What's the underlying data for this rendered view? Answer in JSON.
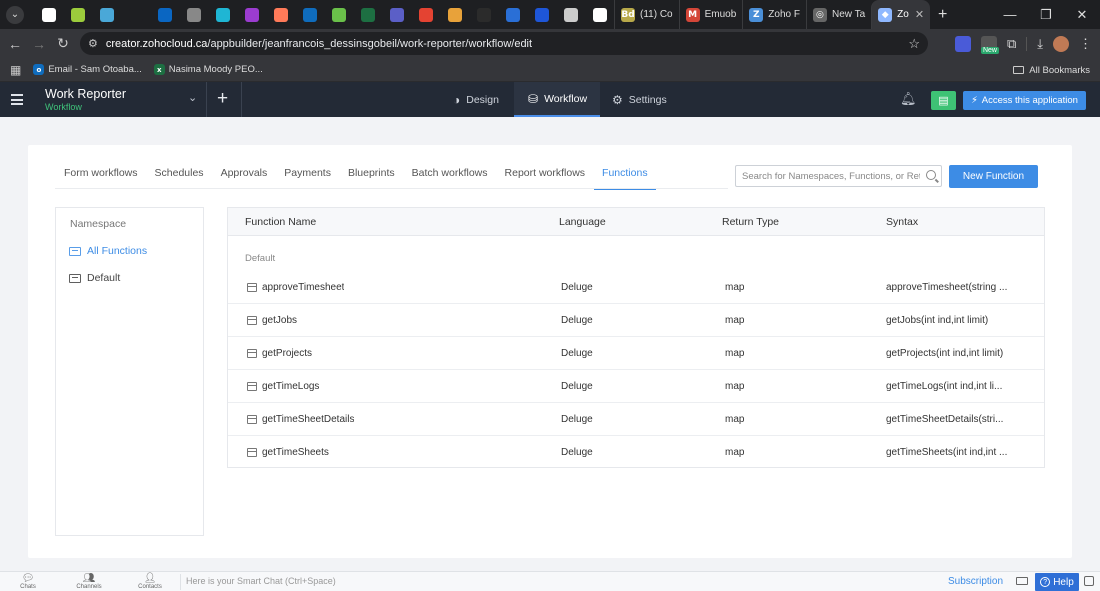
{
  "browser": {
    "pinned_tabs": [
      {
        "icon": "google-icon",
        "color": "#ffffff"
      },
      {
        "icon": "pushbullet-icon",
        "color": "#9ccc3c"
      },
      {
        "icon": "app-icon",
        "color": "#4aa8d8"
      },
      {
        "icon": "upwork-icon",
        "color": "#1e1f22"
      },
      {
        "icon": "linkedin-icon",
        "color": "#0a66c2"
      },
      {
        "icon": "globe-icon",
        "color": "#888888"
      },
      {
        "icon": "canva-icon",
        "color": "#1fb6d4"
      },
      {
        "icon": "app-icon",
        "color": "#9b3cd0"
      },
      {
        "icon": "hubspot-icon",
        "color": "#ff7a59"
      },
      {
        "icon": "outlook-icon",
        "color": "#0f6cbd"
      },
      {
        "icon": "app-icon",
        "color": "#6ac04a"
      },
      {
        "icon": "excel-icon",
        "color": "#1d6f42"
      },
      {
        "icon": "teams-icon",
        "color": "#5b5fc7"
      },
      {
        "icon": "todoist-icon",
        "color": "#e44332"
      },
      {
        "icon": "app-icon",
        "color": "#e8a23a"
      },
      {
        "icon": "stack-icon",
        "color": "#2b2b2b"
      },
      {
        "icon": "app-icon",
        "color": "#2a6fd6"
      },
      {
        "icon": "app-icon",
        "color": "#1e56d8"
      },
      {
        "icon": "chrome-icon",
        "color": "#cccccc"
      },
      {
        "icon": "openai-icon",
        "color": "#ffffff"
      }
    ],
    "tabs": [
      {
        "title": "(11) Co",
        "icon_color": "#b8a94a",
        "icon_text": "Bd"
      },
      {
        "title": "Emuob",
        "icon_color": "#d44638",
        "icon_text": "M"
      },
      {
        "title": "Zoho F",
        "icon_color": "#4a8fd8",
        "icon_text": "Z"
      },
      {
        "title": "New Ta",
        "icon_color": "#666666",
        "icon_text": "◎"
      },
      {
        "title": "Zo",
        "icon_color": "#8fb8ff",
        "icon_text": "◆"
      }
    ],
    "new_tab": "+",
    "url_host": "creator.zohocloud.ca",
    "url_path": "/appbuilder/jeanfrancois_dessinsgobeil/work-reporter/workflow/edit",
    "extension_badge": "New",
    "bookmarks": [
      {
        "label": "Email - Sam Otoaba...",
        "icon_color": "#0f6cbd",
        "icon_text": "o"
      },
      {
        "label": "Nasima Moody PEO...",
        "icon_color": "#1d6f42",
        "icon_text": "x"
      }
    ],
    "all_bookmarks": "All Bookmarks"
  },
  "app": {
    "title": "Work Reporter",
    "subtitle": "Workflow",
    "nav": [
      {
        "label": "Design",
        "icon": "design-icon",
        "active": false
      },
      {
        "label": "Workflow",
        "icon": "workflow-icon",
        "active": true
      },
      {
        "label": "Settings",
        "icon": "gear-icon",
        "active": false
      }
    ],
    "access_button": "Access this application",
    "accent": "#3d8ce5",
    "success": "#3ec275"
  },
  "workflow": {
    "tabs": [
      {
        "label": "Form workflows",
        "active": false
      },
      {
        "label": "Schedules",
        "active": false
      },
      {
        "label": "Approvals",
        "active": false
      },
      {
        "label": "Payments",
        "active": false
      },
      {
        "label": "Blueprints",
        "active": false
      },
      {
        "label": "Batch workflows",
        "active": false
      },
      {
        "label": "Report workflows",
        "active": false
      },
      {
        "label": "Functions",
        "active": true
      }
    ],
    "search_placeholder": "Search for Namespaces, Functions, or Ret",
    "new_function": "New Function"
  },
  "namespace": {
    "heading": "Namespace",
    "items": [
      {
        "label": "All Functions",
        "active": true
      },
      {
        "label": "Default",
        "active": false
      }
    ]
  },
  "functions": {
    "columns": [
      "Function Name",
      "Language",
      "Return Type",
      "Syntax"
    ],
    "group": "Default",
    "rows": [
      {
        "name": "approveTimesheet",
        "language": "Deluge",
        "return_type": "map",
        "syntax": "approveTimesheet(string ..."
      },
      {
        "name": "getJobs",
        "language": "Deluge",
        "return_type": "map",
        "syntax": "getJobs(int ind,int limit)"
      },
      {
        "name": "getProjects",
        "language": "Deluge",
        "return_type": "map",
        "syntax": "getProjects(int ind,int limit)"
      },
      {
        "name": "getTimeLogs",
        "language": "Deluge",
        "return_type": "map",
        "syntax": "getTimeLogs(int ind,int li..."
      },
      {
        "name": "getTimeSheetDetails",
        "language": "Deluge",
        "return_type": "map",
        "syntax": "getTimeSheetDetails(stri..."
      },
      {
        "name": "getTimeSheets",
        "language": "Deluge",
        "return_type": "map",
        "syntax": "getTimeSheets(int ind,int ..."
      }
    ]
  },
  "bottombar": {
    "items": [
      "Chats",
      "Channels",
      "Contacts"
    ],
    "smart_chat_placeholder": "Here is your Smart Chat (Ctrl+Space)",
    "subscription": "Subscription",
    "help": "Help"
  }
}
